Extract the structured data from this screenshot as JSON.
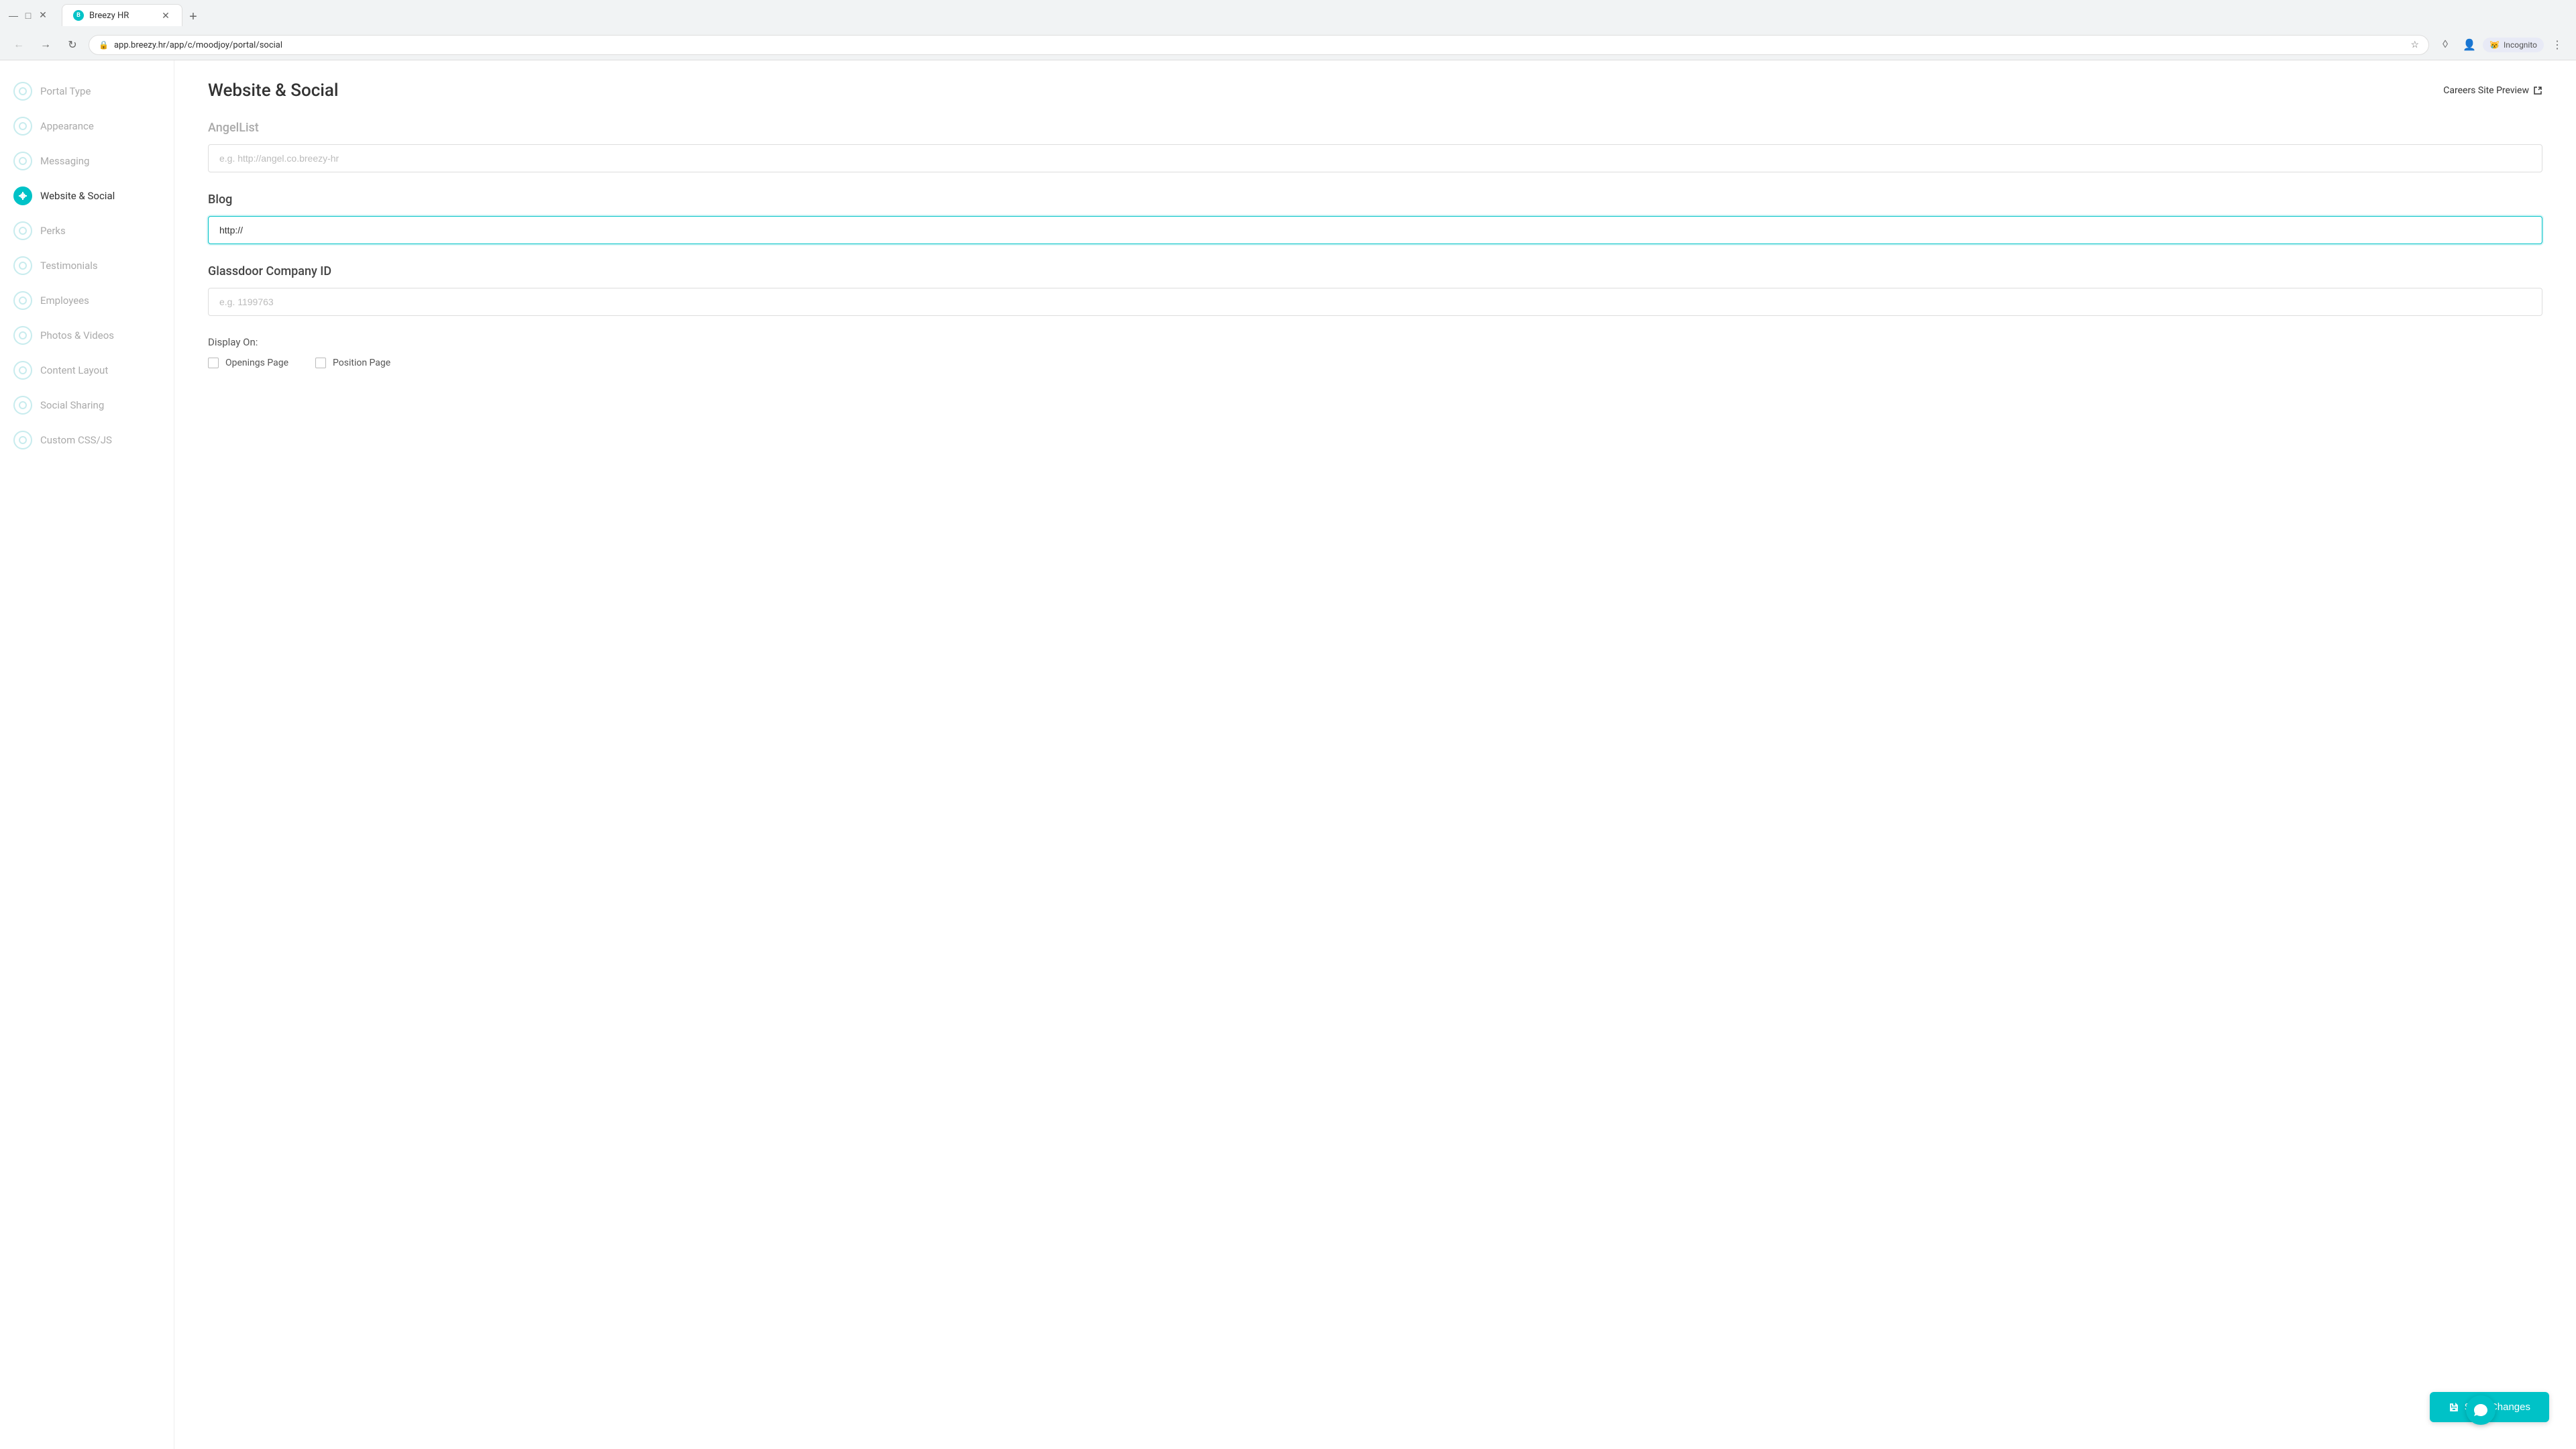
{
  "browser": {
    "tab_label": "Breezy HR",
    "address": "app.breezy.hr/app/c/moodjoy/portal/social",
    "new_tab_icon": "+",
    "incognito_label": "Incognito"
  },
  "sidebar": {
    "items": [
      {
        "id": "portal-type",
        "label": "Portal Type",
        "active": false
      },
      {
        "id": "appearance",
        "label": "Appearance",
        "active": false
      },
      {
        "id": "messaging",
        "label": "Messaging",
        "active": false
      },
      {
        "id": "website-social",
        "label": "Website & Social",
        "active": true
      },
      {
        "id": "perks",
        "label": "Perks",
        "active": false
      },
      {
        "id": "testimonials",
        "label": "Testimonials",
        "active": false
      },
      {
        "id": "employees",
        "label": "Employees",
        "active": false
      },
      {
        "id": "photos-videos",
        "label": "Photos & Videos",
        "active": false
      },
      {
        "id": "content-layout",
        "label": "Content Layout",
        "active": false
      },
      {
        "id": "social-sharing",
        "label": "Social Sharing",
        "active": false
      },
      {
        "id": "custom-css-js",
        "label": "Custom CSS/JS",
        "active": false
      }
    ]
  },
  "main": {
    "page_title": "Website & Social",
    "careers_preview_label": "Careers Site Preview",
    "angellist_section_label": "AngelList",
    "angellist_placeholder": "e.g. http://angel.co.breezy-hr",
    "blog_section_label": "Blog",
    "blog_value": "http://",
    "blog_placeholder": "http://",
    "glassdoor_section_label": "Glassdoor Company ID",
    "glassdoor_placeholder": "e.g. 1199763",
    "display_on_label": "Display On:",
    "openings_page_label": "Openings Page",
    "position_page_label": "Position Page",
    "save_button_label": "Save Changes"
  }
}
